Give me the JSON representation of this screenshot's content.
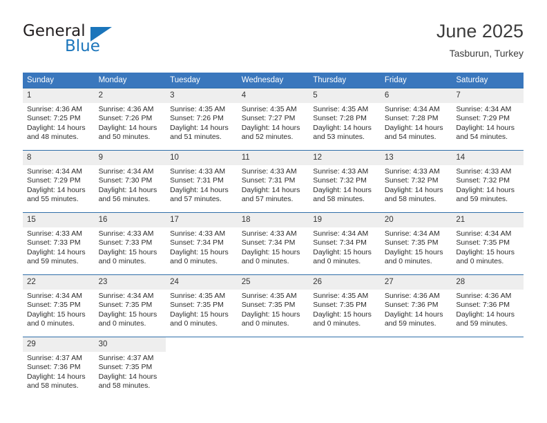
{
  "logo": {
    "primary_text": "General",
    "secondary_text": "Blue",
    "primary_color": "#231f20",
    "accent_color": "#1b75bb",
    "triangle_icon": "triangle-icon"
  },
  "header": {
    "title": "June 2025",
    "location": "Tasburun, Turkey"
  },
  "theme": {
    "header_bg": "#3a77bd",
    "header_text": "#ffffff",
    "daynum_bg": "#eeeeee",
    "row_border": "#2e6da8",
    "body_text": "#2b2b2b"
  },
  "calendar": {
    "weekday_headers": [
      "Sunday",
      "Monday",
      "Tuesday",
      "Wednesday",
      "Thursday",
      "Friday",
      "Saturday"
    ],
    "weeks": [
      [
        {
          "day": "1",
          "sunrise": "Sunrise: 4:36 AM",
          "sunset": "Sunset: 7:25 PM",
          "daylight": "Daylight: 14 hours and 48 minutes."
        },
        {
          "day": "2",
          "sunrise": "Sunrise: 4:36 AM",
          "sunset": "Sunset: 7:26 PM",
          "daylight": "Daylight: 14 hours and 50 minutes."
        },
        {
          "day": "3",
          "sunrise": "Sunrise: 4:35 AM",
          "sunset": "Sunset: 7:26 PM",
          "daylight": "Daylight: 14 hours and 51 minutes."
        },
        {
          "day": "4",
          "sunrise": "Sunrise: 4:35 AM",
          "sunset": "Sunset: 7:27 PM",
          "daylight": "Daylight: 14 hours and 52 minutes."
        },
        {
          "day": "5",
          "sunrise": "Sunrise: 4:35 AM",
          "sunset": "Sunset: 7:28 PM",
          "daylight": "Daylight: 14 hours and 53 minutes."
        },
        {
          "day": "6",
          "sunrise": "Sunrise: 4:34 AM",
          "sunset": "Sunset: 7:28 PM",
          "daylight": "Daylight: 14 hours and 54 minutes."
        },
        {
          "day": "7",
          "sunrise": "Sunrise: 4:34 AM",
          "sunset": "Sunset: 7:29 PM",
          "daylight": "Daylight: 14 hours and 54 minutes."
        }
      ],
      [
        {
          "day": "8",
          "sunrise": "Sunrise: 4:34 AM",
          "sunset": "Sunset: 7:29 PM",
          "daylight": "Daylight: 14 hours and 55 minutes."
        },
        {
          "day": "9",
          "sunrise": "Sunrise: 4:34 AM",
          "sunset": "Sunset: 7:30 PM",
          "daylight": "Daylight: 14 hours and 56 minutes."
        },
        {
          "day": "10",
          "sunrise": "Sunrise: 4:33 AM",
          "sunset": "Sunset: 7:31 PM",
          "daylight": "Daylight: 14 hours and 57 minutes."
        },
        {
          "day": "11",
          "sunrise": "Sunrise: 4:33 AM",
          "sunset": "Sunset: 7:31 PM",
          "daylight": "Daylight: 14 hours and 57 minutes."
        },
        {
          "day": "12",
          "sunrise": "Sunrise: 4:33 AM",
          "sunset": "Sunset: 7:32 PM",
          "daylight": "Daylight: 14 hours and 58 minutes."
        },
        {
          "day": "13",
          "sunrise": "Sunrise: 4:33 AM",
          "sunset": "Sunset: 7:32 PM",
          "daylight": "Daylight: 14 hours and 58 minutes."
        },
        {
          "day": "14",
          "sunrise": "Sunrise: 4:33 AM",
          "sunset": "Sunset: 7:32 PM",
          "daylight": "Daylight: 14 hours and 59 minutes."
        }
      ],
      [
        {
          "day": "15",
          "sunrise": "Sunrise: 4:33 AM",
          "sunset": "Sunset: 7:33 PM",
          "daylight": "Daylight: 14 hours and 59 minutes."
        },
        {
          "day": "16",
          "sunrise": "Sunrise: 4:33 AM",
          "sunset": "Sunset: 7:33 PM",
          "daylight": "Daylight: 15 hours and 0 minutes."
        },
        {
          "day": "17",
          "sunrise": "Sunrise: 4:33 AM",
          "sunset": "Sunset: 7:34 PM",
          "daylight": "Daylight: 15 hours and 0 minutes."
        },
        {
          "day": "18",
          "sunrise": "Sunrise: 4:33 AM",
          "sunset": "Sunset: 7:34 PM",
          "daylight": "Daylight: 15 hours and 0 minutes."
        },
        {
          "day": "19",
          "sunrise": "Sunrise: 4:34 AM",
          "sunset": "Sunset: 7:34 PM",
          "daylight": "Daylight: 15 hours and 0 minutes."
        },
        {
          "day": "20",
          "sunrise": "Sunrise: 4:34 AM",
          "sunset": "Sunset: 7:35 PM",
          "daylight": "Daylight: 15 hours and 0 minutes."
        },
        {
          "day": "21",
          "sunrise": "Sunrise: 4:34 AM",
          "sunset": "Sunset: 7:35 PM",
          "daylight": "Daylight: 15 hours and 0 minutes."
        }
      ],
      [
        {
          "day": "22",
          "sunrise": "Sunrise: 4:34 AM",
          "sunset": "Sunset: 7:35 PM",
          "daylight": "Daylight: 15 hours and 0 minutes."
        },
        {
          "day": "23",
          "sunrise": "Sunrise: 4:34 AM",
          "sunset": "Sunset: 7:35 PM",
          "daylight": "Daylight: 15 hours and 0 minutes."
        },
        {
          "day": "24",
          "sunrise": "Sunrise: 4:35 AM",
          "sunset": "Sunset: 7:35 PM",
          "daylight": "Daylight: 15 hours and 0 minutes."
        },
        {
          "day": "25",
          "sunrise": "Sunrise: 4:35 AM",
          "sunset": "Sunset: 7:35 PM",
          "daylight": "Daylight: 15 hours and 0 minutes."
        },
        {
          "day": "26",
          "sunrise": "Sunrise: 4:35 AM",
          "sunset": "Sunset: 7:35 PM",
          "daylight": "Daylight: 15 hours and 0 minutes."
        },
        {
          "day": "27",
          "sunrise": "Sunrise: 4:36 AM",
          "sunset": "Sunset: 7:36 PM",
          "daylight": "Daylight: 14 hours and 59 minutes."
        },
        {
          "day": "28",
          "sunrise": "Sunrise: 4:36 AM",
          "sunset": "Sunset: 7:36 PM",
          "daylight": "Daylight: 14 hours and 59 minutes."
        }
      ],
      [
        {
          "day": "29",
          "sunrise": "Sunrise: 4:37 AM",
          "sunset": "Sunset: 7:36 PM",
          "daylight": "Daylight: 14 hours and 58 minutes."
        },
        {
          "day": "30",
          "sunrise": "Sunrise: 4:37 AM",
          "sunset": "Sunset: 7:35 PM",
          "daylight": "Daylight: 14 hours and 58 minutes."
        },
        {
          "day": "",
          "sunrise": "",
          "sunset": "",
          "daylight": ""
        },
        {
          "day": "",
          "sunrise": "",
          "sunset": "",
          "daylight": ""
        },
        {
          "day": "",
          "sunrise": "",
          "sunset": "",
          "daylight": ""
        },
        {
          "day": "",
          "sunrise": "",
          "sunset": "",
          "daylight": ""
        },
        {
          "day": "",
          "sunrise": "",
          "sunset": "",
          "daylight": ""
        }
      ]
    ]
  }
}
